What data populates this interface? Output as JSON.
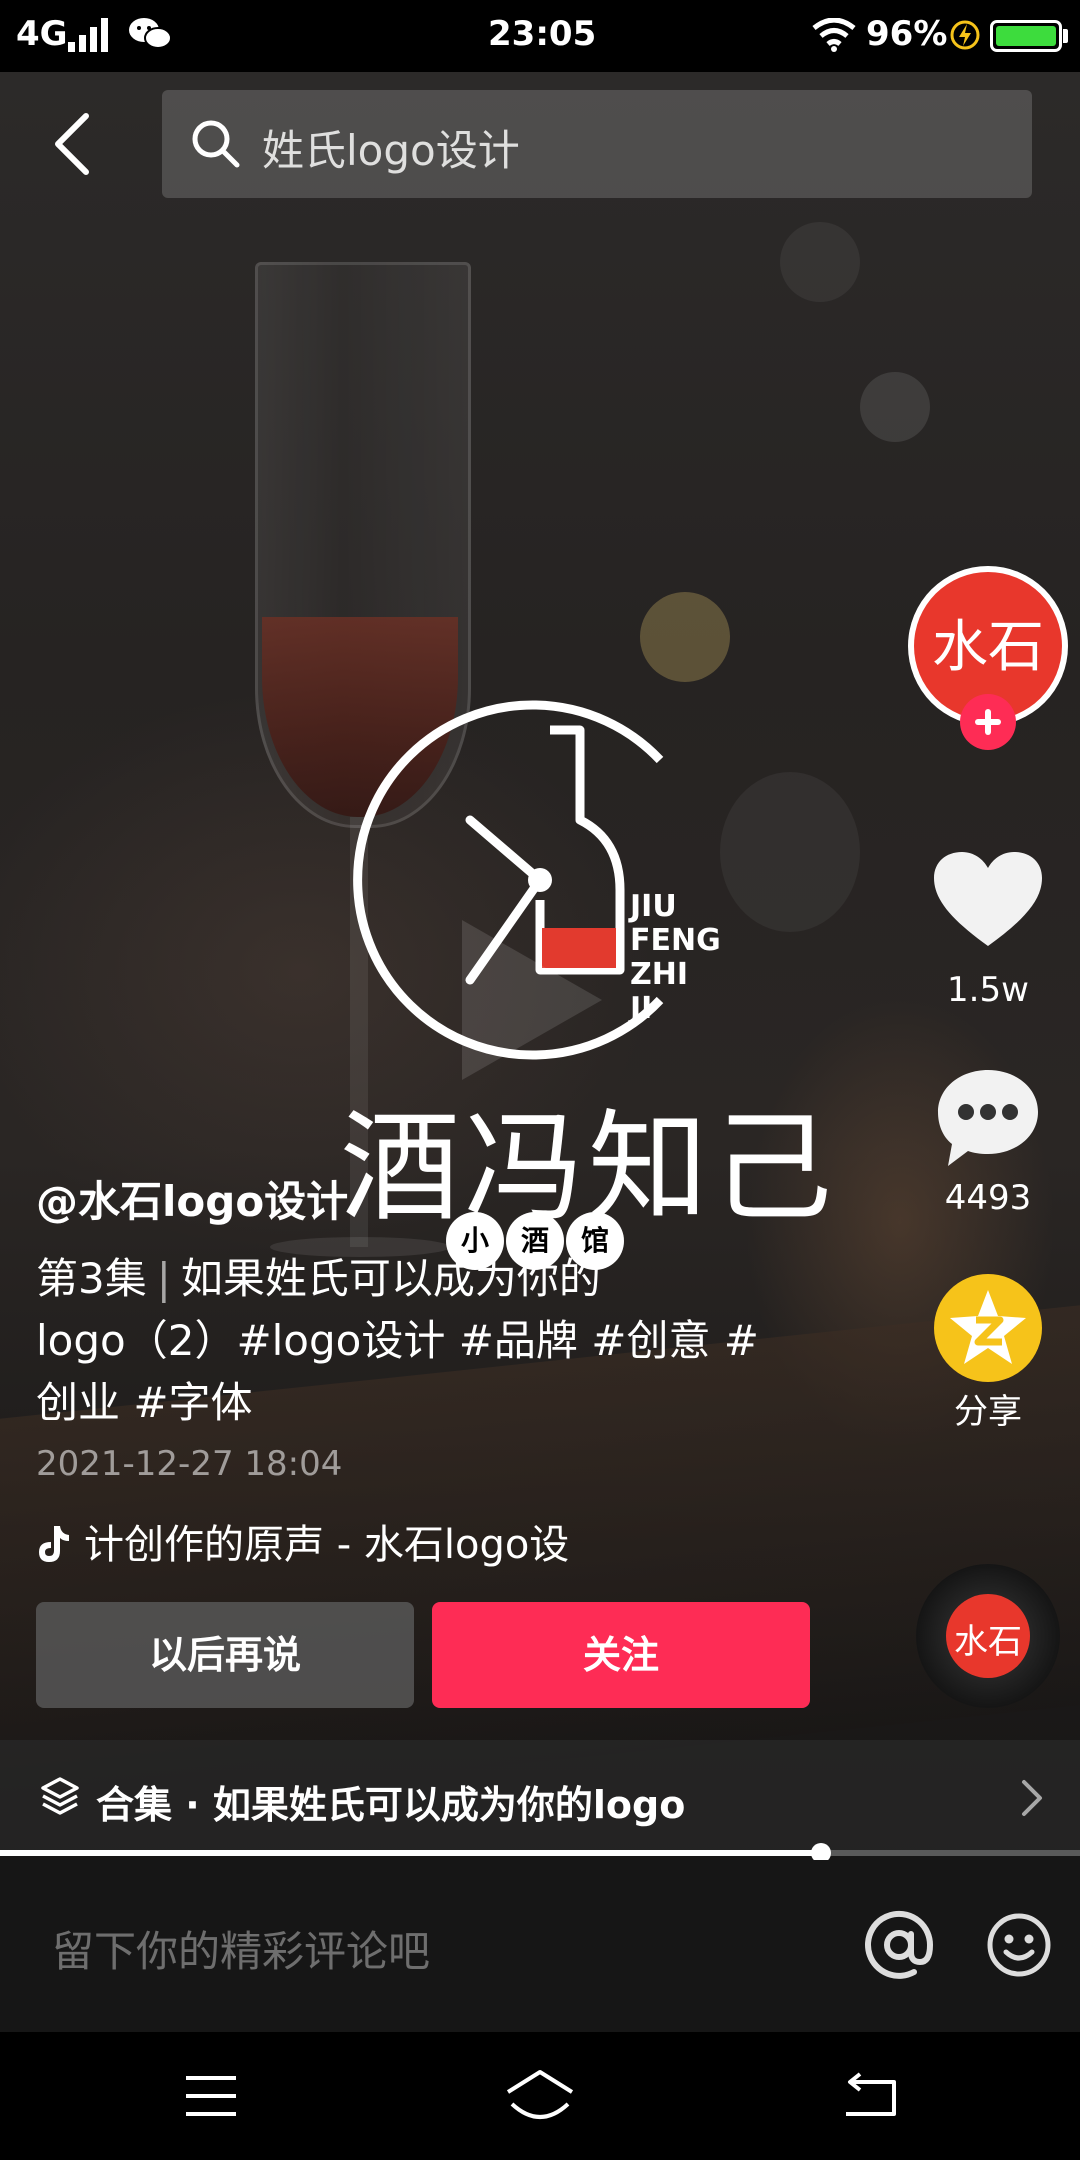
{
  "status_bar": {
    "network": "4G",
    "time": "23:05",
    "battery": "96%"
  },
  "top_bar": {
    "back_icon": "chevron-left-icon",
    "search_icon": "search-icon",
    "search_text": "姓氏logo设计"
  },
  "video": {
    "logo_cn": "酒冯知己",
    "logo_en": [
      "JIU",
      "FENG",
      "ZHI",
      "JI"
    ],
    "logo_sub": [
      "小",
      "酒",
      "馆"
    ]
  },
  "right_rail": {
    "avatar_text": "水石",
    "like_count": "1.5w",
    "comment_count": "4493",
    "share_label": "分享",
    "disc_text": "水石"
  },
  "post": {
    "author": "@水石logo设计",
    "episode": "第3集",
    "description_line1": "如果姓氏可以成为你的",
    "description_line2": "logo（2）#logo设计 #品牌 #创意 #",
    "description_line3": "创业 #字体",
    "date": "2021-12-27 18:04",
    "music": "计创作的原声 - 水石logo设"
  },
  "actions": {
    "later_label": "以后再说",
    "follow_label": "关注"
  },
  "collection": {
    "text": "合集 · 如果姓氏可以成为你的logo"
  },
  "progress": {
    "fraction": 0.76
  },
  "comment": {
    "placeholder": "留下你的精彩评论吧"
  },
  "colors": {
    "accent": "#fe2c55",
    "battery": "#3ddc3d",
    "share": "#f6c31a",
    "avatar_red": "#e8372c"
  }
}
